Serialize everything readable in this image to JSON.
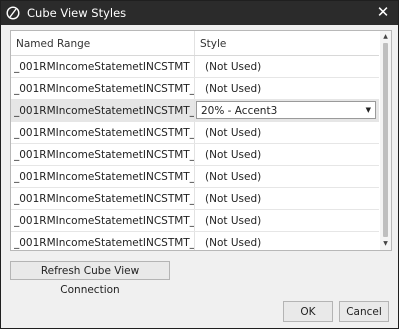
{
  "window": {
    "title": "Cube View Styles",
    "close_glyph": "✕",
    "icon": "app-logo-icon"
  },
  "grid": {
    "columns": [
      "Named Range",
      "Style"
    ],
    "rows": [
      {
        "name": "_001RMIncomeStatemetINCSTMT",
        "style": "(Not Used)",
        "selected": false
      },
      {
        "name": "_001RMIncomeStatemetINCSTMT_C",
        "style": "(Not Used)",
        "selected": false
      },
      {
        "name": "_001RMIncomeStatemetINCSTMT_C",
        "style": "20% - Accent3",
        "selected": true
      },
      {
        "name": "_001RMIncomeStatemetINCSTMT_C",
        "style": "(Not Used)",
        "selected": false
      },
      {
        "name": "_001RMIncomeStatemetINCSTMT_C",
        "style": "(Not Used)",
        "selected": false
      },
      {
        "name": "_001RMIncomeStatemetINCSTMT_C",
        "style": "(Not Used)",
        "selected": false
      },
      {
        "name": "_001RMIncomeStatemetINCSTMT_C",
        "style": "(Not Used)",
        "selected": false
      },
      {
        "name": "_001RMIncomeStatemetINCSTMT_C",
        "style": "(Not Used)",
        "selected": false
      },
      {
        "name": "_001RMIncomeStatemetINCSTMT_C",
        "style": "(Not Used)",
        "selected": false
      }
    ]
  },
  "buttons": {
    "refresh": "Refresh Cube View Connection",
    "ok": "OK",
    "cancel": "Cancel"
  },
  "colors": {
    "titlebar": "#2b2b2b",
    "dialog_bg": "#f0f0f0",
    "selected_row": "#e6e6e6"
  }
}
